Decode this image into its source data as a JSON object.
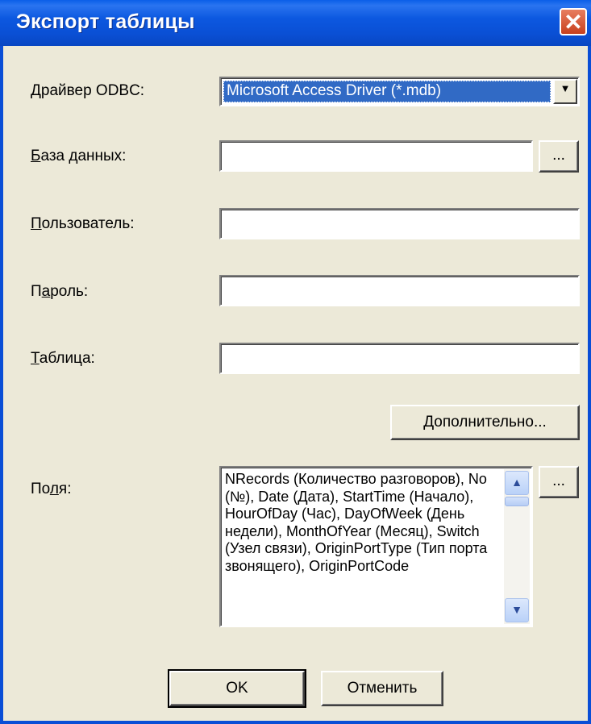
{
  "window": {
    "title": "Экспорт таблицы"
  },
  "odbc": {
    "label_key": "Д",
    "label_rest": "райвер ODBC:",
    "value": "Microsoft Access Driver (*.mdb)"
  },
  "database": {
    "label_key": "Б",
    "label_rest": "аза данных:",
    "value": "",
    "browse_label": "..."
  },
  "user": {
    "label_key": "П",
    "label_rest": "ользователь:",
    "value": ""
  },
  "password": {
    "label_pre": "П",
    "label_key": "а",
    "label_rest": "роль:",
    "value": ""
  },
  "table": {
    "label_key": "Т",
    "label_rest": "аблица:",
    "value": ""
  },
  "advanced": {
    "label_key": "Д",
    "label_rest": "ополнительно..."
  },
  "fields": {
    "label_pre": "По",
    "label_key": "л",
    "label_rest": "я:",
    "list_text": "NRecords (Количество разговоров), No (№), Date (Дата), StartTime (Начало), HourOfDay (Час), DayOfWeek (День недели), MonthOfYear (Месяц), Switch (Узел связи), OriginPortType (Тип порта звонящего), OriginPortCode",
    "browse_label": "..."
  },
  "footer": {
    "ok_label": "OK",
    "cancel_label": "Отменить"
  },
  "icons": {
    "close": "close-icon",
    "dropdown": "chevron-down-icon",
    "scroll_up": "chevron-up-icon",
    "scroll_down": "chevron-down-icon"
  },
  "colors": {
    "titlebar": "#0a4fd4",
    "selection": "#316ac5",
    "dialog_bg": "#ece9d8",
    "close": "#d4532e"
  }
}
